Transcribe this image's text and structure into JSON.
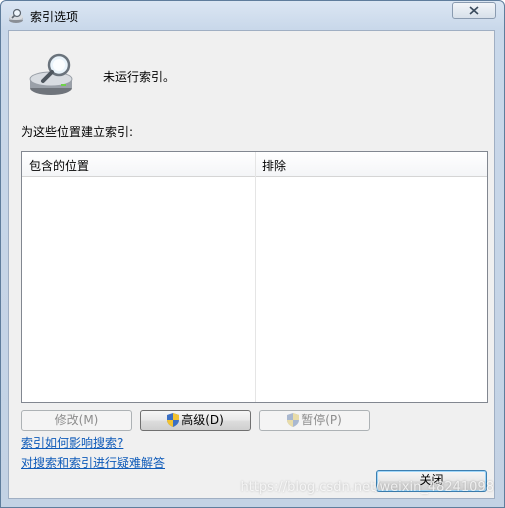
{
  "window": {
    "title": "索引选项",
    "close_glyph": "X"
  },
  "status": {
    "text": "未运行索引。"
  },
  "locations": {
    "label": "为这些位置建立索引:",
    "columns": [
      "包含的位置",
      "排除"
    ],
    "rows": []
  },
  "buttons": {
    "modify": "修改(M)",
    "advanced": "高级(D)",
    "pause": "暂停(P)",
    "close": "关闭"
  },
  "links": {
    "how_indexing_affects": "索引如何影响搜索?",
    "troubleshoot": "对搜索和索引进行疑难解答"
  },
  "watermark": "https://blog.csdn.net/weixin_48241098",
  "colors": {
    "link": "#0f5bb9",
    "titlebar": "#dbe6f3",
    "client_bg": "#f0f0f0"
  },
  "icons": {
    "title": "index-options-icon",
    "status": "indexing-drive-magnifier-icon",
    "shield": "uac-shield-icon"
  }
}
